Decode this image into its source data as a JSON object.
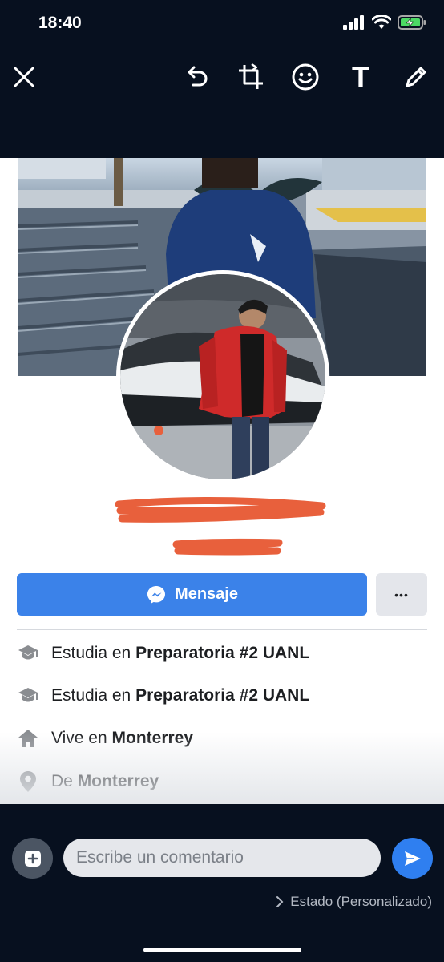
{
  "status_bar": {
    "time": "18:40"
  },
  "editor_toolbar": {
    "icons": [
      "close-icon",
      "undo-icon",
      "crop-icon",
      "emoji-icon",
      "text-icon",
      "pencil-icon"
    ],
    "text_tool_glyph": "T"
  },
  "profile": {
    "message_button_label": "Mensaje",
    "more_button_glyph": "•••",
    "info_rows": [
      {
        "icon": "graduation-cap-icon",
        "prefix": "Estudia en ",
        "value": "Preparatoria #2 UANL"
      },
      {
        "icon": "graduation-cap-icon",
        "prefix": "Estudia en ",
        "value": "Preparatoria #2 UANL"
      },
      {
        "icon": "house-icon",
        "prefix": "Vive en ",
        "value": "Monterrey"
      },
      {
        "icon": "location-pin-icon",
        "prefix": "De ",
        "value": "Monterrey"
      }
    ]
  },
  "comment_bar": {
    "placeholder": "Escribe un comentario",
    "status_label": "Estado (Personalizado)"
  },
  "colors": {
    "background": "#07101f",
    "accent_blue": "#3b82e9",
    "send_blue": "#2f7ff0",
    "redaction": "#e8603c"
  }
}
